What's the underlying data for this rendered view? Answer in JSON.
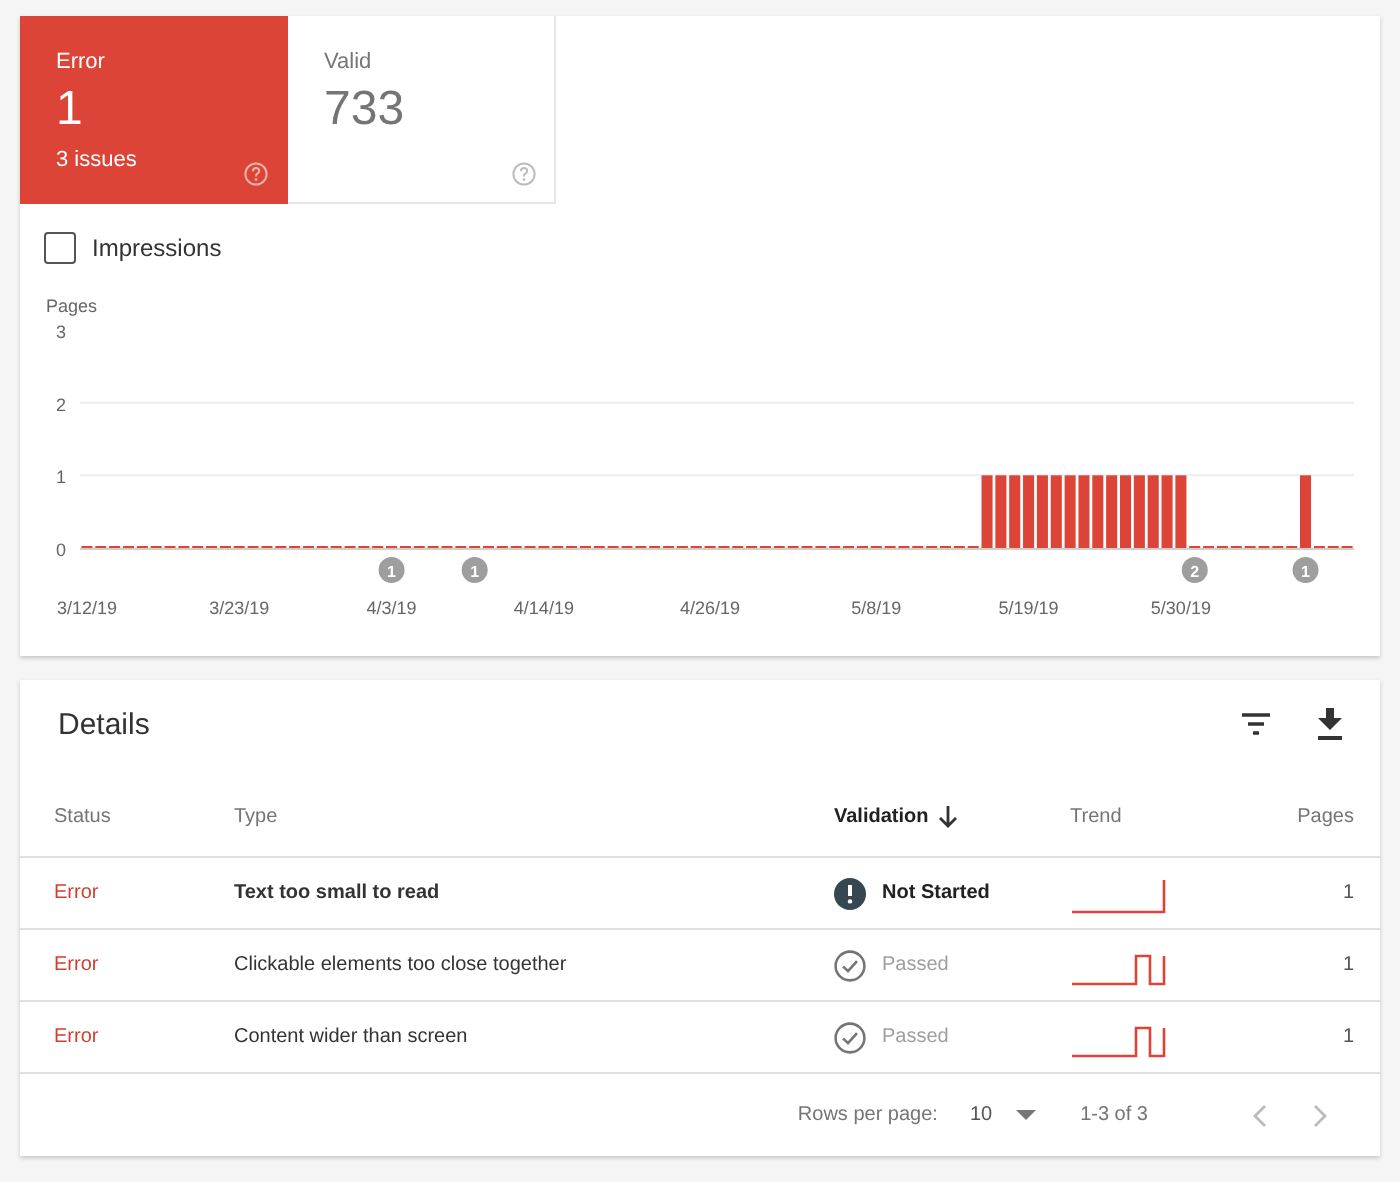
{
  "tiles": [
    {
      "label": "Error",
      "value": "1",
      "sub": "3 issues",
      "selected": true
    },
    {
      "label": "Valid",
      "value": "733",
      "selected": false
    }
  ],
  "impressions": {
    "label": "Impressions",
    "checked": false
  },
  "chart": {
    "chart_data": {
      "type": "bar",
      "ylabel": "Pages",
      "ylim": [
        0,
        3
      ],
      "yticks": [
        0,
        1,
        2,
        3
      ],
      "categories": [
        "3/12/19",
        null,
        null,
        null,
        null,
        null,
        null,
        null,
        null,
        null,
        null,
        "3/23/19",
        null,
        null,
        null,
        null,
        null,
        null,
        null,
        null,
        null,
        null,
        "4/3/19",
        null,
        null,
        null,
        null,
        null,
        null,
        null,
        null,
        null,
        null,
        "4/14/19",
        null,
        null,
        null,
        null,
        null,
        null,
        null,
        null,
        null,
        null,
        null,
        "4/26/19",
        null,
        null,
        null,
        null,
        null,
        null,
        null,
        null,
        null,
        null,
        null,
        "5/8/19",
        null,
        null,
        null,
        null,
        null,
        null,
        null,
        null,
        null,
        null,
        "5/19/19",
        null,
        null,
        null,
        null,
        null,
        null,
        null,
        null,
        null,
        null,
        "5/30/19",
        null,
        null,
        null,
        null,
        null,
        null,
        null,
        null,
        null,
        null,
        null,
        null
      ],
      "series": [
        {
          "color": "#db4437",
          "values": [
            0,
            0,
            0,
            0,
            0,
            0,
            0,
            0,
            0,
            0,
            0,
            0,
            0,
            0,
            0,
            0,
            0,
            0,
            0,
            0,
            0,
            0,
            0,
            0,
            0,
            0,
            0,
            0,
            0,
            0,
            0,
            0,
            0,
            0,
            0,
            0,
            0,
            0,
            0,
            0,
            0,
            0,
            0,
            0,
            0,
            0,
            0,
            0,
            0,
            0,
            0,
            0,
            0,
            0,
            0,
            0,
            0,
            0,
            0,
            0,
            0,
            0,
            0,
            0,
            0,
            1,
            1,
            1,
            1,
            1,
            1,
            1,
            1,
            1,
            1,
            1,
            1,
            1,
            1,
            1,
            0,
            0,
            0,
            0,
            0,
            0,
            0,
            0,
            1,
            0,
            0,
            0
          ]
        }
      ],
      "annotations": [
        "1",
        "1",
        "2",
        "1"
      ]
    }
  },
  "details": {
    "title": "Details",
    "columns": [
      {
        "label": "Status",
        "sorted": false
      },
      {
        "label": "Type",
        "sorted": false
      },
      {
        "label": "Validation",
        "sorted": true
      },
      {
        "label": "Trend",
        "sorted": false
      },
      {
        "label": "Pages",
        "sorted": false
      }
    ],
    "rows": [
      {
        "status": "Error",
        "type": "Text too small to read",
        "emphasized": true,
        "validation": {
          "label": "Not Started",
          "kind": "not-started"
        },
        "trend": {
          "kind": "step"
        },
        "pages": "1"
      },
      {
        "status": "Error",
        "type": "Clickable elements too close together",
        "emphasized": false,
        "validation": {
          "label": "Passed",
          "kind": "passed"
        },
        "trend": {
          "kind": "pulse"
        },
        "pages": "1"
      },
      {
        "status": "Error",
        "type": "Content wider than screen",
        "emphasized": false,
        "validation": {
          "label": "Passed",
          "kind": "passed"
        },
        "trend": {
          "kind": "pulse"
        },
        "pages": "1"
      }
    ],
    "footer": {
      "rows_label": "Rows per page:",
      "rows_value": "10",
      "range": "1-3 of 3"
    }
  }
}
